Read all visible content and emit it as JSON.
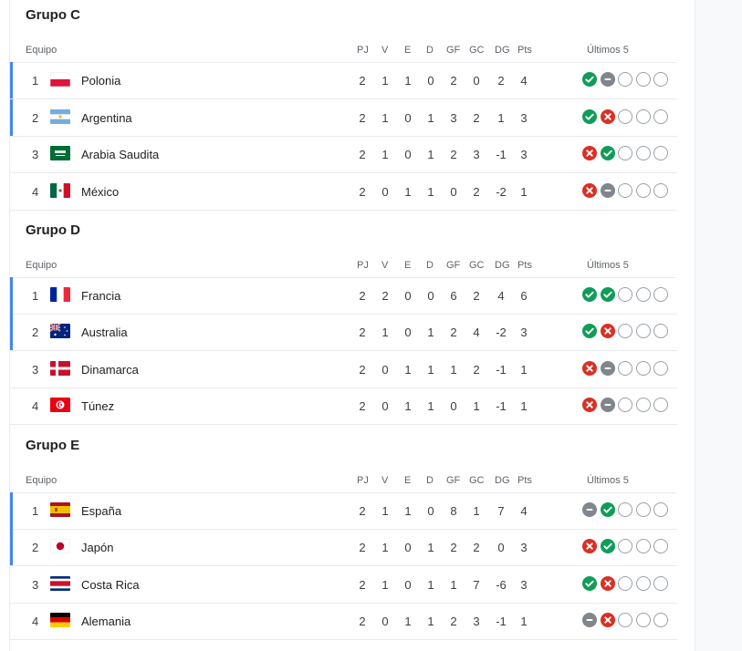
{
  "headers": {
    "team": "Equipo",
    "pj": "PJ",
    "v": "V",
    "e": "E",
    "d": "D",
    "gf": "GF",
    "gc": "GC",
    "dg": "DG",
    "pts": "Pts",
    "last5": "Últimos 5"
  },
  "colors": {
    "win": "#0f9d58",
    "loss": "#d93025",
    "draw": "#80868b",
    "qualified": "#4285f4"
  },
  "groups": [
    {
      "title": "Grupo C",
      "rows": [
        {
          "pos": "1",
          "team": "Polonia",
          "flag": "flag-poland",
          "pj": "2",
          "v": "1",
          "e": "1",
          "d": "0",
          "gf": "2",
          "gc": "0",
          "dg": "2",
          "pts": "4",
          "last5": [
            "win",
            "draw",
            "none",
            "none",
            "none"
          ],
          "qualified": true
        },
        {
          "pos": "2",
          "team": "Argentina",
          "flag": "flag-argentina",
          "pj": "2",
          "v": "1",
          "e": "0",
          "d": "1",
          "gf": "3",
          "gc": "2",
          "dg": "1",
          "pts": "3",
          "last5": [
            "win",
            "loss",
            "none",
            "none",
            "none"
          ],
          "qualified": true
        },
        {
          "pos": "3",
          "team": "Arabia Saudita",
          "flag": "flag-saudi-arabia",
          "pj": "2",
          "v": "1",
          "e": "0",
          "d": "1",
          "gf": "2",
          "gc": "3",
          "dg": "-1",
          "pts": "3",
          "last5": [
            "loss",
            "win",
            "none",
            "none",
            "none"
          ],
          "qualified": false
        },
        {
          "pos": "4",
          "team": "México",
          "flag": "flag-mexico",
          "pj": "2",
          "v": "0",
          "e": "1",
          "d": "1",
          "gf": "0",
          "gc": "2",
          "dg": "-2",
          "pts": "1",
          "last5": [
            "loss",
            "draw",
            "none",
            "none",
            "none"
          ],
          "qualified": false
        }
      ]
    },
    {
      "title": "Grupo D",
      "rows": [
        {
          "pos": "1",
          "team": "Francia",
          "flag": "flag-france",
          "pj": "2",
          "v": "2",
          "e": "0",
          "d": "0",
          "gf": "6",
          "gc": "2",
          "dg": "4",
          "pts": "6",
          "last5": [
            "win",
            "win",
            "none",
            "none",
            "none"
          ],
          "qualified": true
        },
        {
          "pos": "2",
          "team": "Australia",
          "flag": "flag-australia",
          "pj": "2",
          "v": "1",
          "e": "0",
          "d": "1",
          "gf": "2",
          "gc": "4",
          "dg": "-2",
          "pts": "3",
          "last5": [
            "win",
            "loss",
            "none",
            "none",
            "none"
          ],
          "qualified": true
        },
        {
          "pos": "3",
          "team": "Dinamarca",
          "flag": "flag-denmark",
          "pj": "2",
          "v": "0",
          "e": "1",
          "d": "1",
          "gf": "1",
          "gc": "2",
          "dg": "-1",
          "pts": "1",
          "last5": [
            "loss",
            "draw",
            "none",
            "none",
            "none"
          ],
          "qualified": false
        },
        {
          "pos": "4",
          "team": "Túnez",
          "flag": "flag-tunisia",
          "pj": "2",
          "v": "0",
          "e": "1",
          "d": "1",
          "gf": "0",
          "gc": "1",
          "dg": "-1",
          "pts": "1",
          "last5": [
            "loss",
            "draw",
            "none",
            "none",
            "none"
          ],
          "qualified": false
        }
      ]
    },
    {
      "title": "Grupo E",
      "rows": [
        {
          "pos": "1",
          "team": "España",
          "flag": "flag-spain",
          "pj": "2",
          "v": "1",
          "e": "1",
          "d": "0",
          "gf": "8",
          "gc": "1",
          "dg": "7",
          "pts": "4",
          "last5": [
            "draw",
            "win",
            "none",
            "none",
            "none"
          ],
          "qualified": true
        },
        {
          "pos": "2",
          "team": "Japón",
          "flag": "flag-japan",
          "pj": "2",
          "v": "1",
          "e": "0",
          "d": "1",
          "gf": "2",
          "gc": "2",
          "dg": "0",
          "pts": "3",
          "last5": [
            "loss",
            "win",
            "none",
            "none",
            "none"
          ],
          "qualified": true
        },
        {
          "pos": "3",
          "team": "Costa Rica",
          "flag": "flag-costa-rica",
          "pj": "2",
          "v": "1",
          "e": "0",
          "d": "1",
          "gf": "1",
          "gc": "7",
          "dg": "-6",
          "pts": "3",
          "last5": [
            "win",
            "loss",
            "none",
            "none",
            "none"
          ],
          "qualified": false
        },
        {
          "pos": "4",
          "team": "Alemania",
          "flag": "flag-germany",
          "pj": "2",
          "v": "0",
          "e": "1",
          "d": "1",
          "gf": "2",
          "gc": "3",
          "dg": "-1",
          "pts": "1",
          "last5": [
            "draw",
            "loss",
            "none",
            "none",
            "none"
          ],
          "qualified": false
        }
      ]
    }
  ]
}
